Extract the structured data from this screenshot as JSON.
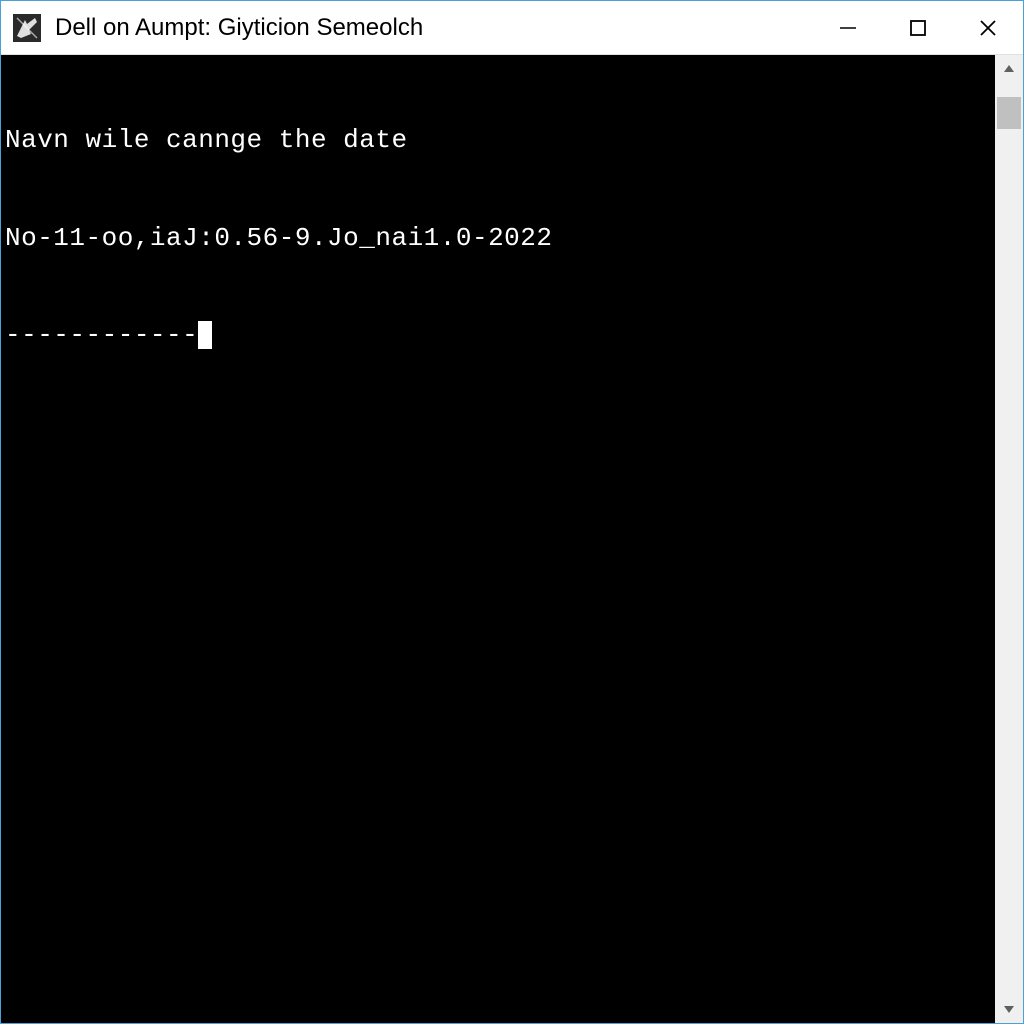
{
  "window": {
    "title": "Dell on Aumpt: Giyticion Semeolch"
  },
  "console": {
    "lines": [
      "Navn wile cannge the date",
      "No-11-oo,iaJ:0.56-9.Jo_nai1.0-2022",
      "------------"
    ]
  }
}
